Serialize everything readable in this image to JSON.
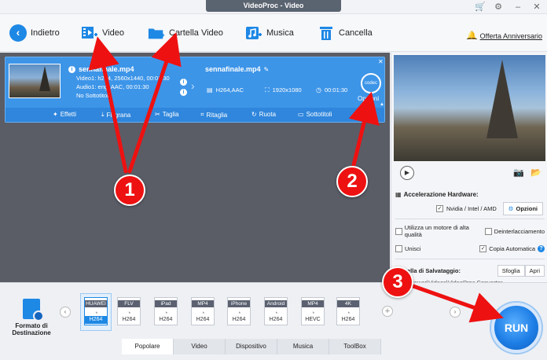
{
  "window": {
    "title": "VideoProc - Video"
  },
  "toolbar": {
    "back": "Indietro",
    "video": "Video",
    "folder": "Cartella Video",
    "music": "Musica",
    "delete": "Cancella",
    "offer": "Offerta Anniversario"
  },
  "file": {
    "source_name": "sennafinale.mp4",
    "video_line": "Video1: h264, 2560x1440, 00:01:30",
    "audio_line": "Audio1: eng, AAC, 00:01:30",
    "subtitle_line": "No Sottotitoli",
    "output_name": "sennafinale.mp4",
    "codec": "H264,AAC",
    "resolution": "1920x1080",
    "duration": "00:01:30",
    "codec_badge": "codec",
    "options": "Opzioni"
  },
  "actions": [
    "Effetti",
    "Filigrana",
    "Taglia",
    "Ritaglia",
    "Ruota",
    "Sottotitoli"
  ],
  "right": {
    "hw_title": "Accelerazione Hardware:",
    "hw_option": "Nvidia / Intel / AMD",
    "hw_button": "Opzioni",
    "opt_quality": "Utilizza un motore di alta qualità",
    "opt_deinterlace": "Deinterlacciamento",
    "opt_merge": "Unisci",
    "opt_autocopy": "Copia Automatica",
    "save_title": "Cartella di Salvataggio:",
    "browse": "Sfoglia",
    "open": "Apri",
    "path": "...ers\\Power\\Videos\\VideoProc Converter"
  },
  "formats": [
    {
      "top": "HUAWEI",
      "bot": "H264"
    },
    {
      "top": "FLV",
      "bot": "H264"
    },
    {
      "top": "iPad",
      "bot": "H264"
    },
    {
      "top": "MP4",
      "bot": "H264"
    },
    {
      "top": "iPhone",
      "bot": "H264"
    },
    {
      "top": "Android",
      "bot": "H264"
    },
    {
      "top": "MP4",
      "bot": "HEVC"
    },
    {
      "top": "4K",
      "bot": "H264"
    }
  ],
  "bottom": {
    "dest_label": "Formato di Destinazione",
    "tabs": [
      "Popolare",
      "Video",
      "Dispositivo",
      "Musica",
      "ToolBox"
    ],
    "run": "RUN"
  },
  "annotations": {
    "n1": "1",
    "n2": "2",
    "n3": "3"
  },
  "colors": {
    "accent": "#1e88e5",
    "card": "#3d95e8",
    "annotation": "#e11111"
  }
}
